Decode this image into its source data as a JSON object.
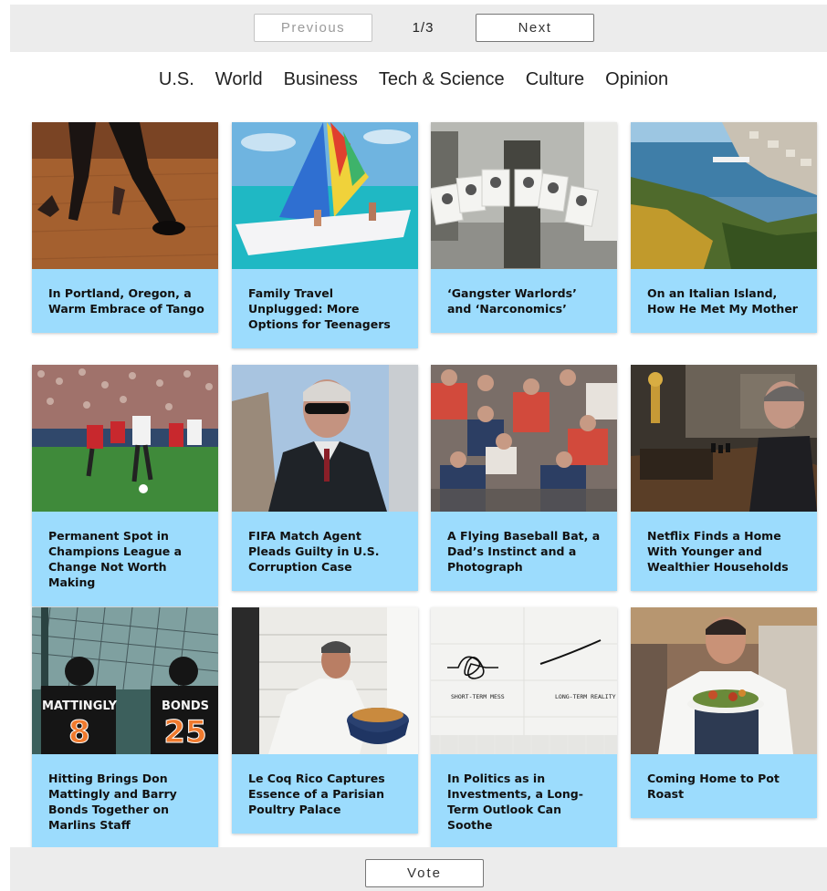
{
  "pagination": {
    "previous_label": "Previous",
    "next_label": "Next",
    "page_indicator": "1/3"
  },
  "sections": [
    "U.S.",
    "World",
    "Business",
    "Tech & Science",
    "Culture",
    "Opinion"
  ],
  "articles": [
    {
      "headline": "In Portland, Oregon, a Warm Embrace of Tango",
      "image": "tango-dancers-photo"
    },
    {
      "headline": "Family Travel Unplugged: More Options for Teenagers",
      "image": "sailboat-photo"
    },
    {
      "headline": "‘Gangster Warlords’ and ‘Narconomics’",
      "image": "protest-posters-photo"
    },
    {
      "headline": "On an Italian Island, How He Met My Mother",
      "image": "island-harbor-photo"
    },
    {
      "headline": "Permanent Spot in Champions League a Change Not Worth Making",
      "image": "soccer-match-photo"
    },
    {
      "headline": "FIFA Match Agent Pleads Guilty in U.S. Corruption Case",
      "image": "man-sunglasses-photo"
    },
    {
      "headline": "A Flying Baseball Bat, a Dad’s Instinct and a Photograph",
      "image": "baseball-crowd-photo"
    },
    {
      "headline": "Netflix Finds a Home With Younger and Wealthier Households",
      "image": "man-chess-photo"
    },
    {
      "headline": "Hitting Brings Don Mattingly and Barry Bonds Together on Marlins Staff",
      "image": "marlins-coaches-photo"
    },
    {
      "headline": "Le Coq Rico Captures Essence of a Parisian Poultry Palace",
      "image": "chef-pot-photo"
    },
    {
      "headline": "In Politics as in Investments, a Long-Term Outlook Can Soothe",
      "image": "napkin-sketch-photo"
    },
    {
      "headline": "Coming Home to Pot Roast",
      "image": "chef-bowl-photo"
    }
  ],
  "sketch": {
    "left_label": "SHORT-TERM MESS",
    "right_label": "LONG-TERM REALITY"
  },
  "jerseys": [
    {
      "name": "MATTINGLY",
      "number": "8"
    },
    {
      "name": "BONDS",
      "number": "25"
    }
  ],
  "vote_label": "Vote",
  "colors": {
    "card_background": "#9cdcfd",
    "bar_background": "#ececec"
  }
}
